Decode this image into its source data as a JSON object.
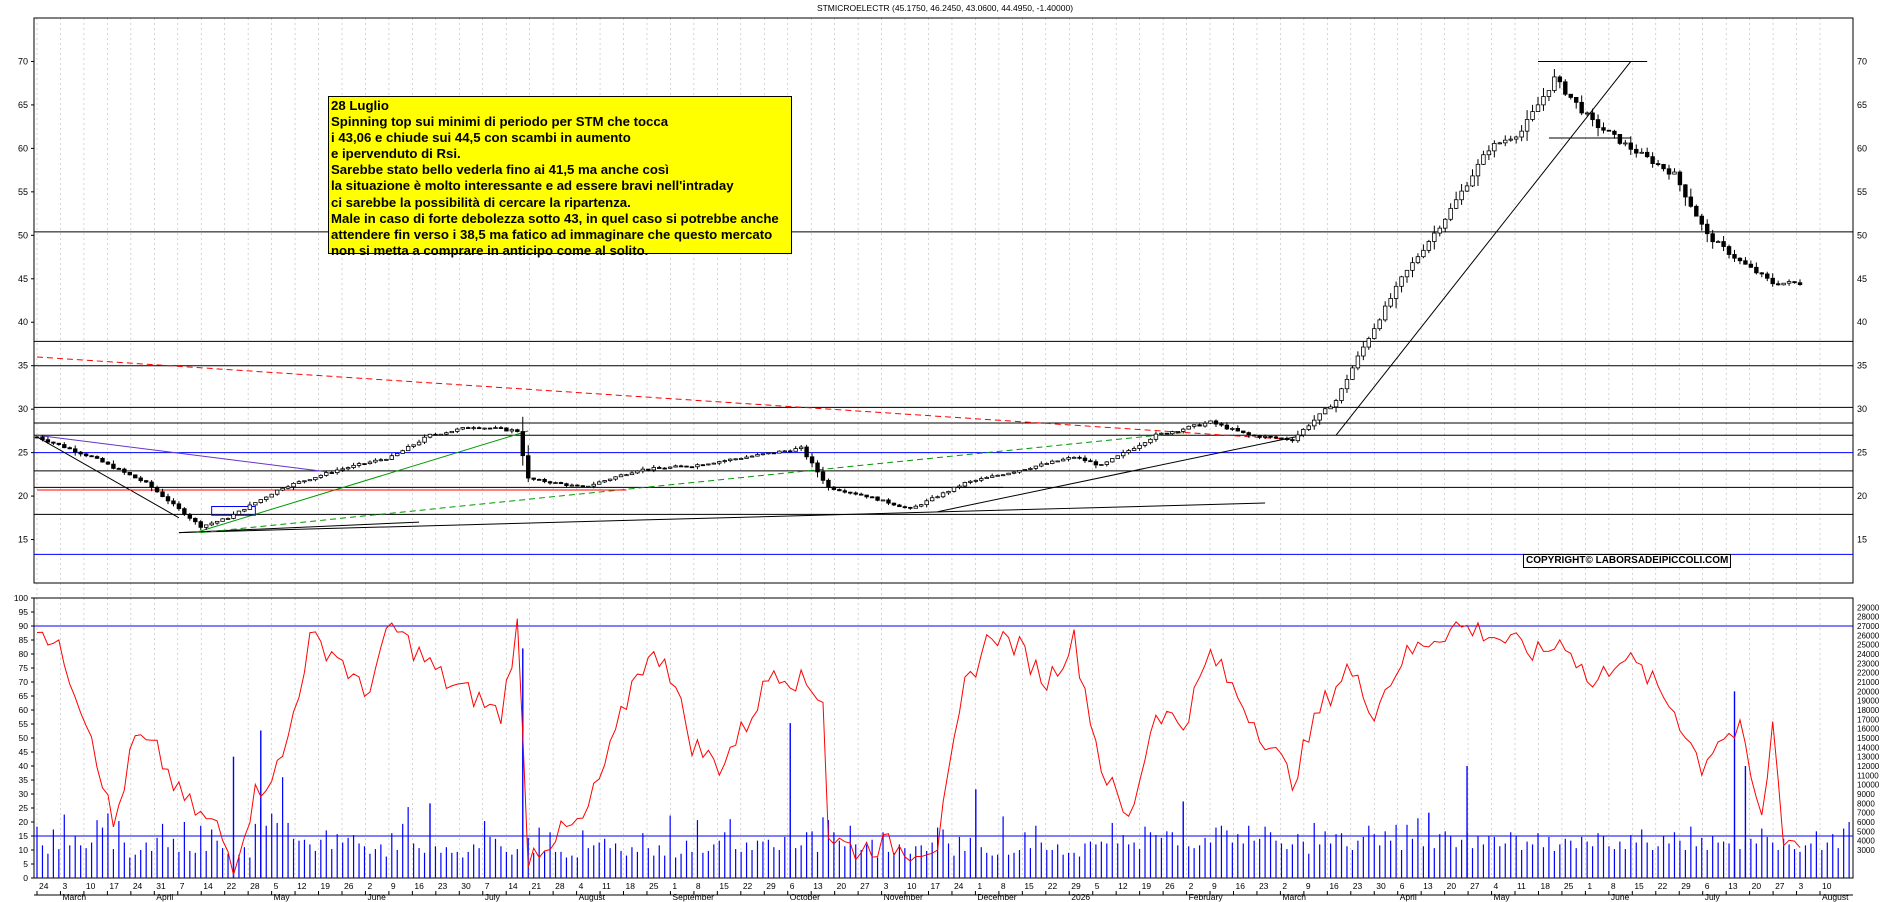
{
  "chart_data": [
    {
      "type": "candlestick",
      "title": "STMICROELECTR (45.1750, 46.2450, 43.0600, 44.4950, -1.40000)",
      "ylim": [
        10,
        75
      ],
      "y_ticks": [
        15,
        20,
        25,
        30,
        35,
        40,
        45,
        50,
        55,
        60,
        65,
        70
      ],
      "x_tick_labels": [
        "24",
        "3",
        "10",
        "17",
        "24",
        "31",
        "7",
        "14",
        "22",
        "28",
        "5",
        "12",
        "19",
        "26",
        "2",
        "9",
        "16",
        "23",
        "30",
        "7",
        "14",
        "21",
        "28",
        "4",
        "11",
        "18",
        "25",
        "1",
        "8",
        "15",
        "22",
        "29",
        "6",
        "13",
        "20",
        "27",
        "3",
        "10",
        "17",
        "24",
        "1",
        "8",
        "15",
        "22",
        "29",
        "5",
        "12",
        "19",
        "26",
        "2",
        "9",
        "16",
        "23",
        "2",
        "9",
        "16",
        "23",
        "30",
        "6",
        "13",
        "20",
        "27",
        "4",
        "11",
        "18",
        "25",
        "1",
        "8",
        "15",
        "22",
        "29",
        "6",
        "13",
        "20",
        "27",
        "3",
        "10"
      ],
      "month_labels": [
        "March",
        "April",
        "May",
        "June",
        "July",
        "August",
        "September",
        "October",
        "November",
        "December",
        "2026",
        "February",
        "March",
        "April",
        "May",
        "June",
        "July",
        "August"
      ],
      "horizontal_levels": [
        13.3,
        17.9,
        21.0,
        22.9,
        25.0,
        27.0,
        28.4,
        30.2,
        35.0,
        37.8,
        50.4,
        61.2,
        70.0
      ],
      "close_path": [
        [
          0,
          26.8
        ],
        [
          10,
          24.5
        ],
        [
          20,
          21.5
        ],
        [
          30,
          16.5
        ],
        [
          35,
          17.5
        ],
        [
          45,
          21.0
        ],
        [
          55,
          23.0
        ],
        [
          65,
          24.5
        ],
        [
          72,
          27.0
        ],
        [
          80,
          28.0
        ],
        [
          88,
          27.5
        ],
        [
          90,
          22.0
        ],
        [
          100,
          21.0
        ],
        [
          110,
          23.0
        ],
        [
          120,
          23.5
        ],
        [
          130,
          24.5
        ],
        [
          140,
          25.5
        ],
        [
          145,
          21.0
        ],
        [
          152,
          20.0
        ],
        [
          160,
          18.5
        ],
        [
          170,
          21.5
        ],
        [
          180,
          23.0
        ],
        [
          190,
          24.5
        ],
        [
          195,
          23.5
        ],
        [
          205,
          27.0
        ],
        [
          215,
          28.5
        ],
        [
          222,
          27.0
        ],
        [
          230,
          26.5
        ],
        [
          238,
          31.0
        ],
        [
          242,
          36.0
        ],
        [
          250,
          45.0
        ],
        [
          258,
          52.0
        ],
        [
          266,
          60.0
        ],
        [
          272,
          62.0
        ],
        [
          278,
          68.0
        ],
        [
          285,
          63.0
        ],
        [
          292,
          60.0
        ],
        [
          300,
          57.0
        ],
        [
          306,
          50.0
        ],
        [
          312,
          47.0
        ],
        [
          318,
          44.5
        ]
      ],
      "volume_scale": [
        29000,
        28000,
        27000,
        26000,
        25000,
        24000,
        23000,
        22000,
        21000,
        20000,
        19000,
        18000,
        17000,
        16000,
        15000,
        14000,
        13000,
        12000,
        11000,
        10000,
        9000,
        8000,
        7000,
        6000,
        5000,
        4000,
        3000
      ]
    },
    {
      "type": "line",
      "ylim": [
        0,
        100
      ],
      "y_ticks": [
        0,
        5,
        10,
        15,
        20,
        25,
        30,
        35,
        40,
        45,
        50,
        55,
        60,
        65,
        70,
        75,
        80,
        85,
        90,
        95,
        100
      ],
      "reference_levels": [
        90,
        15
      ],
      "series": [
        {
          "color": "#ff0000",
          "points": [
            [
              0,
              92
            ],
            [
              5,
              78
            ],
            [
              10,
              52
            ],
            [
              14,
              18
            ],
            [
              18,
              50
            ],
            [
              22,
              45
            ],
            [
              26,
              30
            ],
            [
              30,
              22
            ],
            [
              33,
              18
            ],
            [
              36,
              5
            ],
            [
              40,
              30
            ],
            [
              45,
              42
            ],
            [
              50,
              85
            ],
            [
              55,
              80
            ],
            [
              60,
              65
            ],
            [
              65,
              90
            ],
            [
              70,
              80
            ],
            [
              75,
              70
            ],
            [
              80,
              65
            ],
            [
              85,
              58
            ],
            [
              88,
              90
            ],
            [
              90,
              8
            ],
            [
              95,
              15
            ],
            [
              100,
              20
            ],
            [
              105,
              45
            ],
            [
              110,
              75
            ],
            [
              115,
              80
            ],
            [
              120,
              48
            ],
            [
              125,
              40
            ],
            [
              130,
              55
            ],
            [
              135,
              75
            ],
            [
              140,
              70
            ],
            [
              144,
              65
            ],
            [
              145,
              15
            ],
            [
              150,
              10
            ],
            [
              155,
              12
            ],
            [
              160,
              10
            ],
            [
              165,
              12
            ],
            [
              170,
              68
            ],
            [
              175,
              88
            ],
            [
              180,
              82
            ],
            [
              185,
              70
            ],
            [
              190,
              85
            ],
            [
              195,
              40
            ],
            [
              200,
              20
            ],
            [
              205,
              60
            ],
            [
              210,
              55
            ],
            [
              215,
              80
            ],
            [
              220,
              65
            ],
            [
              225,
              50
            ],
            [
              230,
              35
            ],
            [
              235,
              60
            ],
            [
              240,
              75
            ],
            [
              245,
              60
            ],
            [
              250,
              78
            ],
            [
              255,
              85
            ],
            [
              260,
              90
            ],
            [
              265,
              88
            ],
            [
              270,
              84
            ],
            [
              275,
              80
            ],
            [
              280,
              85
            ],
            [
              285,
              68
            ],
            [
              290,
              80
            ],
            [
              295,
              72
            ],
            [
              300,
              60
            ],
            [
              305,
              40
            ],
            [
              308,
              50
            ],
            [
              312,
              52
            ],
            [
              316,
              20
            ],
            [
              318,
              55
            ],
            [
              320,
              15
            ],
            [
              323,
              12
            ]
          ]
        }
      ]
    },
    {
      "type": "bar",
      "series": [
        {
          "color": "#0000ff",
          "values": [
            5500,
            3500,
            2600,
            5200,
            3100,
            6800,
            3500,
            4500,
            3500,
            3200,
            3800,
            6200,
            5400,
            6900,
            3100,
            6100,
            3800,
            2200,
            2500,
            3000,
            3800,
            2900,
            4300,
            5800,
            3300,
            4200,
            2800,
            6000,
            2900,
            2700,
            5600,
            2900,
            5200,
            4000,
            3200,
            2600,
            2500,
            2500,
            3300,
            2200,
            5800,
            7600,
            5600,
            6900,
            5900,
            10800,
            5900,
            4200,
            4000,
            4100,
            3600,
            2900,
            4100,
            5100,
            3100,
            4700,
            3800,
            4300,
            4600,
            3700,
            3400,
            2600,
            3100,
            3600,
            2300,
            4800,
            3000,
            5800,
            7600,
            3700,
            3200,
            2700,
            2800,
            3400,
            2700,
            3300,
            2700,
            2800,
            2200,
            2800,
            3600,
            3200,
            6100,
            4400,
            4200,
            3400,
            2800,
            2500,
            3100,
            3200,
            4300,
            2700,
            5400,
            2900,
            4900,
            2800,
            2800,
            2200,
            2400,
            2200,
            5100,
            3200,
            3500,
            3800,
            4200,
            3200,
            3700,
            2900,
            2400,
            3300,
            2800,
            4800,
            3200,
            2400,
            3500,
            2400,
            6700,
            2200,
            2600,
            4000,
            2800,
            6200,
            2700,
            2900,
            3600,
            4000,
            4900,
            6300,
            3100,
            2800,
            3800,
            3000,
            4000,
            3900,
            4100,
            3300,
            3000,
            4400,
            3000,
            3200,
            3500,
            4900,
            5000,
            2800,
            6500,
            6200,
            4900,
            4000,
            3400,
            5600,
            3600,
            3000,
            3600,
            4100,
            2200,
            4900,
            2800,
            2700,
            3600,
            3200,
            2600,
            3400,
            3500,
            2900,
            3800,
            5400,
            5200,
            3700,
            2400,
            4400,
            2900,
            4300,
            3100,
            3300,
            2700,
            2400,
            2500,
            6600,
            2500,
            2700,
            3000,
            4900,
            3200,
            5600,
            3800,
            3000,
            3000,
            3600,
            2500,
            2700,
            2700,
            2300,
            3700,
            3900,
            3600,
            3900,
            3700,
            5900,
            3700,
            4600,
            3600,
            3800,
            3100,
            5500,
            4900,
            4600,
            4300,
            5000,
            4900,
            3500,
            4100,
            3400,
            3200,
            3500,
            4300,
            3800,
            5400,
            5600,
            5100,
            3800,
            4700,
            3700,
            5600,
            4000,
            4200,
            5500,
            4900,
            4000,
            3700,
            3100,
            3600,
            4700,
            3900,
            2600,
            5900,
            3600,
            5000,
            3700,
            4700,
            4800,
            3400,
            3000,
            4000,
            4400,
            5600,
            4700,
            3500,
            5000,
            4000,
            5700,
            3000,
            5700,
            4200,
            6400,
            3400,
            3800,
            3200,
            4700,
            5000,
            4500,
            3300,
            4100,
            5000,
            3200,
            4500,
            3600,
            4500,
            4400,
            3400,
            3700,
            4900,
            4500,
            3000,
            3900,
            3600,
            4800,
            3300,
            4400,
            2900,
            3600,
            4200,
            4000,
            3200,
            4400,
            3900,
            3400,
            4800,
            4500,
            3400,
            3100,
            3900,
            3100,
            4600,
            3800,
            5200,
            3800,
            3000,
            3400,
            4500,
            3700,
            4900,
            4000,
            3000,
            5500,
            3400,
            4300,
            3000,
            4500,
            3800,
            3900,
            3700,
            4300,
            3100,
            4000,
            4200,
            3700,
            5300,
            4400,
            3800,
            3000,
            4200,
            3600,
            3100,
            2800,
            3500,
            3700,
            5000,
            3000,
            3800,
            4700,
            3200,
            5300,
            6000
          ]
        }
      ],
      "spikes": [
        [
          36,
          13000
        ],
        [
          41,
          15800
        ],
        [
          72,
          8000
        ],
        [
          89,
          24600
        ],
        [
          138,
          16600
        ],
        [
          172,
          9500
        ],
        [
          210,
          8200
        ],
        [
          255,
          7000
        ],
        [
          262,
          12000
        ],
        [
          311,
          20000
        ],
        [
          313,
          12000
        ]
      ]
    }
  ],
  "note": {
    "lines": [
      "28 Luglio",
      "Spinning top sui minimi di periodo per STM che tocca",
      "i 43,06 e chiude sui 44,5 con scambi in aumento",
      "e ipervenduto di Rsi.",
      "Sarebbe stato bello vederla fino ai 41,5 ma anche così",
      "la situazione è molto interessante e ad essere bravi nell'intraday",
      "ci sarebbe la possibilità di cercare la ripartenza.",
      "Male in caso di forte debolezza sotto 43, in quel caso si potrebbe anche",
      "attendere fin verso i 38,5 ma fatico ad immaginare che questo mercato",
      "non si metta a comprare in anticipo come al solito."
    ]
  },
  "copyright": "COPYRIGHT© LABORSADEIPICCOLI.COM",
  "colors": {
    "price": "#000000",
    "rsi": "#ff0000",
    "volume": "#0000ff",
    "note_background": "#ffff00",
    "support_blue": "#0000ff",
    "trend_red": "#ff0000",
    "trend_green": "#009900",
    "trend_purple": "#6633cc"
  }
}
